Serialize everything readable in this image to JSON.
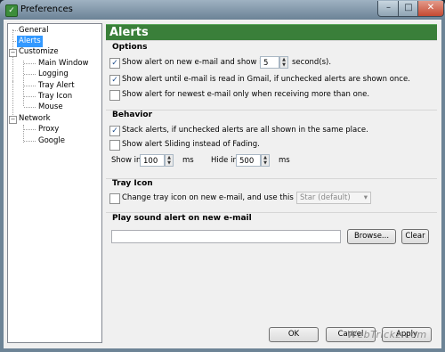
{
  "window": {
    "title": "Preferences",
    "min": "–",
    "max": "□",
    "close": "✕",
    "app_icon_char": "✓"
  },
  "tree": {
    "items": [
      {
        "label": "General"
      },
      {
        "label": "Alerts",
        "selected": true
      },
      {
        "label": "Customize"
      },
      {
        "label": "Main Window"
      },
      {
        "label": "Logging"
      },
      {
        "label": "Tray Alert"
      },
      {
        "label": "Tray Icon"
      },
      {
        "label": "Mouse"
      },
      {
        "label": "Network"
      },
      {
        "label": "Proxy"
      },
      {
        "label": "Google"
      }
    ]
  },
  "header": {
    "title": "Alerts"
  },
  "options": {
    "title": "Options",
    "show_alert_label": "Show alert on new e-mail and show it for",
    "show_alert_checked": true,
    "seconds_value": "5",
    "seconds_unit": "second(s).",
    "until_read_label": "Show alert until e-mail is read in Gmail, if unchecked alerts are shown once.",
    "until_read_checked": true,
    "newest_only_label": "Show alert for newest e-mail only when receiving more than one.",
    "newest_only_checked": false
  },
  "behavior": {
    "title": "Behavior",
    "stack_label": "Stack alerts, if unchecked alerts are all shown in the same place.",
    "stack_checked": true,
    "sliding_label": "Show alert Sliding instead of Fading.",
    "sliding_checked": false,
    "show_in_label": "Show in",
    "show_in_value": "100",
    "show_in_unit": "ms",
    "hide_in_label": "Hide in",
    "hide_in_value": "500",
    "hide_in_unit": "ms"
  },
  "tray_icon": {
    "title": "Tray Icon",
    "change_label": "Change tray icon on new e-mail, and use this icon:",
    "change_checked": false,
    "icon_selected": "Star (default)"
  },
  "sound": {
    "title": "Play sound alert on new e-mail",
    "path_value": "",
    "browse_label": "Browse...",
    "clear_label": "Clear"
  },
  "footer": {
    "ok_label": "OK",
    "cancel_label": "Cancel",
    "apply_label": "Apply"
  },
  "watermark": "WebTrickz.com"
}
